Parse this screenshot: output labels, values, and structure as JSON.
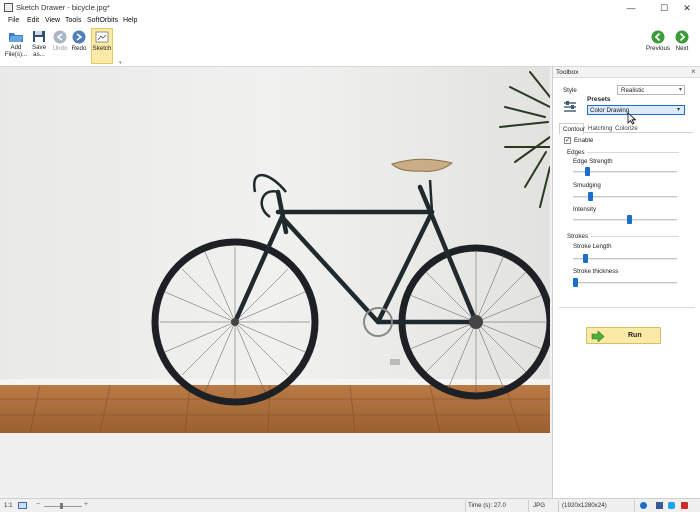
{
  "window": {
    "title": "Sketch Drawer - bicycle.jpg*",
    "minimize": "—",
    "maximize": "☐",
    "close": "✕"
  },
  "menu": [
    "File",
    "Edit",
    "View",
    "Tools",
    "SoftOrbits",
    "Help"
  ],
  "toolbar": {
    "add_files": [
      "Add",
      "File(s)..."
    ],
    "save_as": [
      "Save",
      "as..."
    ],
    "undo": "Undo",
    "redo": "Redo",
    "sketch": "Sketch",
    "previous": "Previous",
    "next": "Next"
  },
  "toolbox": {
    "title": "Toolbox",
    "close": "×",
    "style_label": "Style",
    "style_value": "Realistic",
    "presets_label": "Presets",
    "preset_value": "Color Drawing",
    "tabs": [
      "Contour",
      "Hatching",
      "Colorize"
    ],
    "enable_label": "Enable",
    "enable_checked": true,
    "edges_label": "Edges",
    "edge_strength_label": "Edge Strength",
    "edge_strength": 0.12,
    "smudging_label": "Smudging",
    "smudging": 0.15,
    "intensity_label": "Intensity",
    "intensity": 0.55,
    "strokes_label": "Strokes",
    "stroke_length_label": "Stroke Length",
    "stroke_length": 0.1,
    "stroke_thickness_label": "Stroke thickness",
    "stroke_thickness": 0.0,
    "run_label": "Run"
  },
  "status": {
    "zoom_ratio": "1:1",
    "time": "Time (s): 27.0",
    "format": "JPG",
    "dimensions": "(1920x1280x24)"
  },
  "colors": {
    "accent_blue": "#1b6fc9",
    "run_button": "#fbe9a6",
    "green_nav": "#3a9d3a"
  }
}
